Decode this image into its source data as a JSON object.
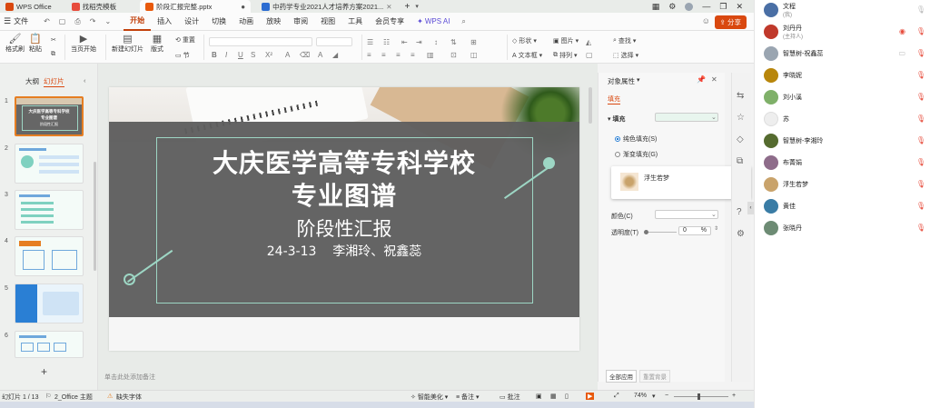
{
  "tabbar": {
    "tabs": [
      {
        "label": "WPS Office",
        "icon": "wps-logo-icon",
        "color": "#d9480f"
      },
      {
        "label": "找稻壳模板",
        "icon": "docer-icon",
        "color": "#e74c3c"
      },
      {
        "label": "阶段汇报完整.pptx",
        "icon": "pptx-icon",
        "color": "#e8590c",
        "active": true
      },
      {
        "label": "中药学专业2021人才培养方案2021...",
        "icon": "docx-icon",
        "color": "#2b6cd1"
      }
    ],
    "new_tab": "+"
  },
  "menubar": {
    "file_label": "文件",
    "items": [
      "开始",
      "插入",
      "设计",
      "切换",
      "动画",
      "放映",
      "审阅",
      "视图",
      "工具",
      "会员专享"
    ],
    "active_index": 0,
    "ai_label": "WPS AI",
    "share_label": "分享"
  },
  "ribbon": {
    "format_painter": "格式刷",
    "paste": "粘贴",
    "from_current": "当页开始",
    "new_slide": "新建幻灯片",
    "layout": "版式",
    "section": "节",
    "reset": "重置",
    "shape": "形状",
    "picture": "图片",
    "find": "查找",
    "textbox": "文本框",
    "arrange": "排列",
    "select": "选择"
  },
  "leftpanel": {
    "outline_tab": "大纲",
    "slides_tab": "幻灯片",
    "slide_numbers": [
      "1",
      "2",
      "3",
      "4",
      "5",
      "6"
    ],
    "add": "+"
  },
  "slide": {
    "title_line1": "大庆医学高等专科学校",
    "title_line2": "专业图谱",
    "subtitle": "阶段性汇报",
    "byline": "24-3-13    李湘玲、祝鑫蕊"
  },
  "thumb1": {
    "t1": "大庆医学高等专科学校",
    "t2": "专业图谱",
    "t3": "阶段性汇报"
  },
  "notes_placeholder": "单击此处添加备注",
  "props": {
    "title": "对象属性",
    "fill_tab": "填充",
    "fill_label": "填充",
    "solid_fill": "纯色填充(S)",
    "gradient_fill": "渐变填充(G)",
    "popup_label": "浮生若梦",
    "color_label": "颜色(C)",
    "transparency_label": "透明度(T)",
    "transparency_value": "0",
    "percent": "%",
    "apply_all": "全部应用",
    "reset_bg": "重置背景"
  },
  "statusbar": {
    "slide_pos": "幻灯片 1 / 13",
    "theme": "2_Office 主题",
    "missing_font": "缺失字体",
    "smart_beautify": "智能美化",
    "notes": "备注",
    "comments": "批注",
    "zoom": "74%"
  },
  "participants": [
    {
      "name": "文程",
      "sub": "(我)",
      "color": "#4a6fa5",
      "mic_off": false
    },
    {
      "name": "刘丹丹",
      "sub": "(主持人)",
      "color": "#c0392b",
      "mic_off": true
    },
    {
      "name": "智慧树-祝鑫蕊",
      "sub": "",
      "color": "#9aa5b1",
      "mic_off": true
    },
    {
      "name": "李晓妮",
      "sub": "",
      "color": "#b8860b",
      "mic_off": true
    },
    {
      "name": "刘小溪",
      "sub": "",
      "color": "#7fb069",
      "mic_off": true
    },
    {
      "name": "苏",
      "sub": "",
      "color": "#eeeeee",
      "mic_off": true
    },
    {
      "name": "智慧树-李湘玲",
      "sub": "",
      "color": "#556b2f",
      "mic_off": true
    },
    {
      "name": "布菁娟",
      "sub": "",
      "color": "#8e6c8a",
      "mic_off": true
    },
    {
      "name": "浮生若梦",
      "sub": "",
      "color": "#c9a36b",
      "mic_off": true
    },
    {
      "name": "黄佳",
      "sub": "",
      "color": "#3a7ca5",
      "mic_off": true
    },
    {
      "name": "张晓丹",
      "sub": "",
      "color": "#6d8b74",
      "mic_off": true
    }
  ],
  "colors": {
    "accent": "#d9480f",
    "slide_overlay": "#5e5e5e",
    "teal_line": "#9dd6c4"
  }
}
